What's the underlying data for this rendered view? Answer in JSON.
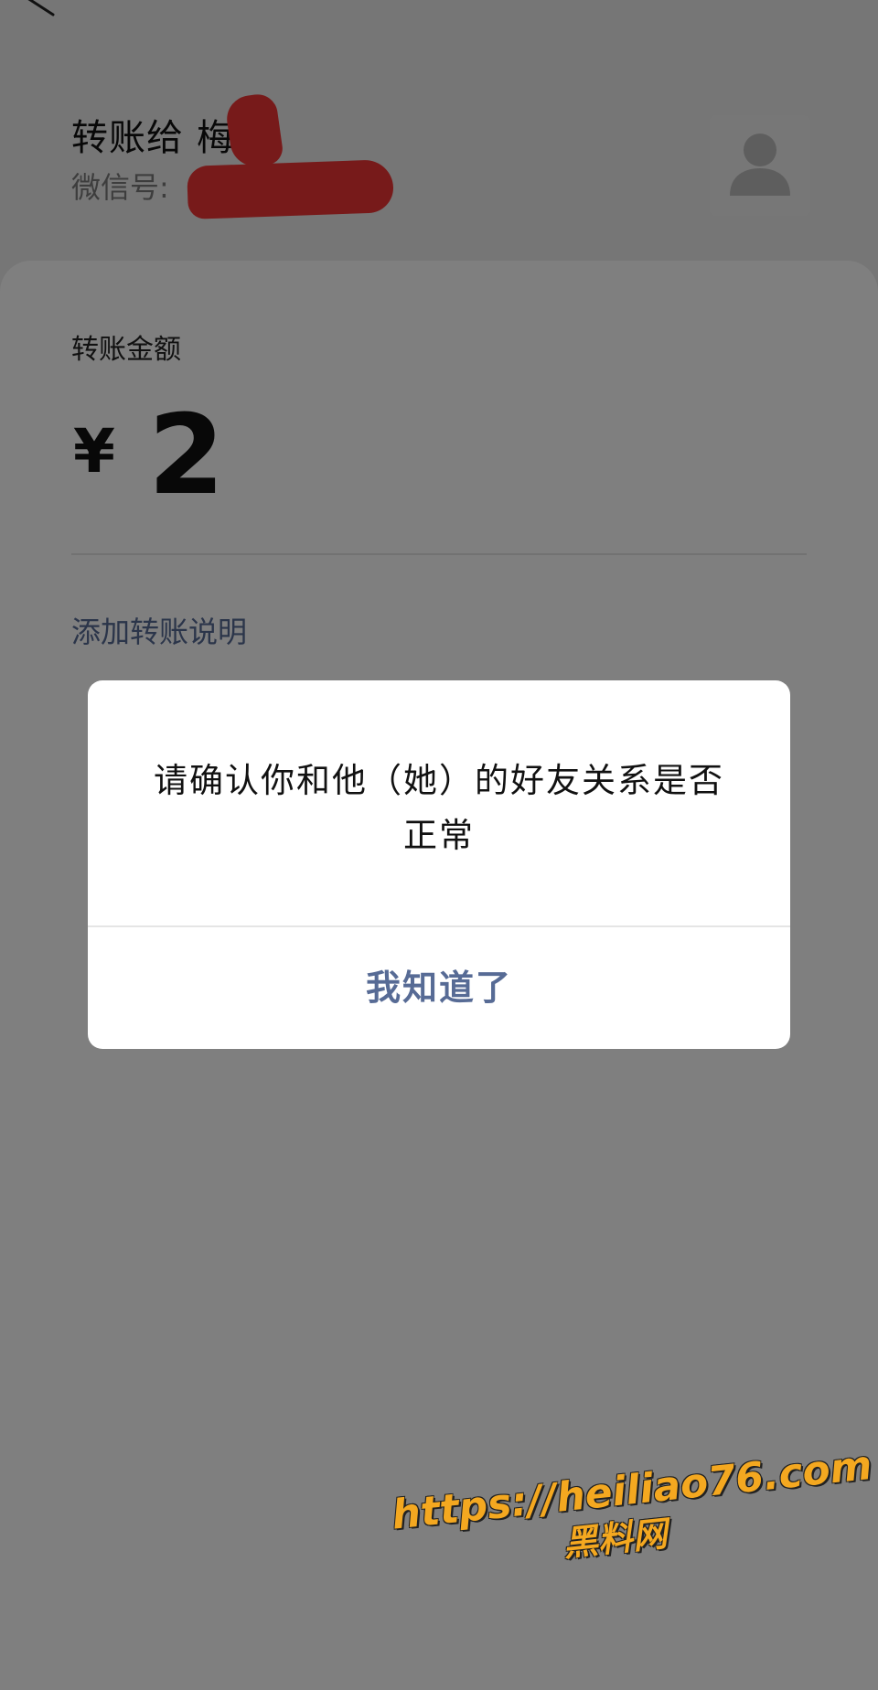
{
  "header": {
    "title_prefix": "转账给",
    "recipient_name": "梅亮",
    "wechat_id_label": "微信号:"
  },
  "card": {
    "amount_label": "转账金额",
    "currency_symbol": "¥",
    "amount": "2",
    "add_note_link": "添加转账说明"
  },
  "dialog": {
    "message": "请确认你和他（她）的好友关系是否正常",
    "confirm_button": "我知道了"
  },
  "watermark": {
    "url": "https://heiliao76.com",
    "site_name": "黑料网"
  },
  "colors": {
    "link": "#576b95",
    "redaction": "#ee3535",
    "watermark": "#f4a820"
  },
  "icons": {
    "back": "back-arrow-icon",
    "avatar": "default-avatar-icon"
  }
}
